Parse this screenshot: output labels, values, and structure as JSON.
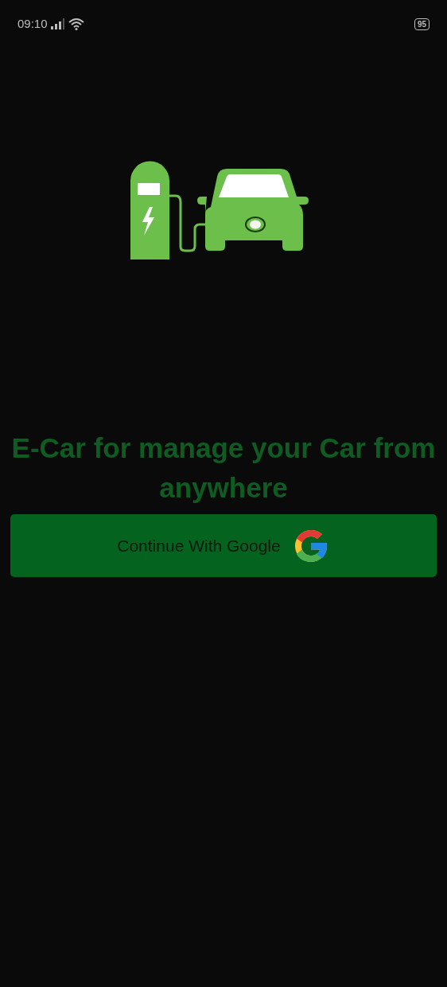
{
  "status_bar": {
    "time": "09:10",
    "battery": "95"
  },
  "headline": "E-Car for manage your Car from anywhere",
  "buttons": [
    {
      "kind": "google",
      "label": "Continue With Google"
    }
  ]
}
